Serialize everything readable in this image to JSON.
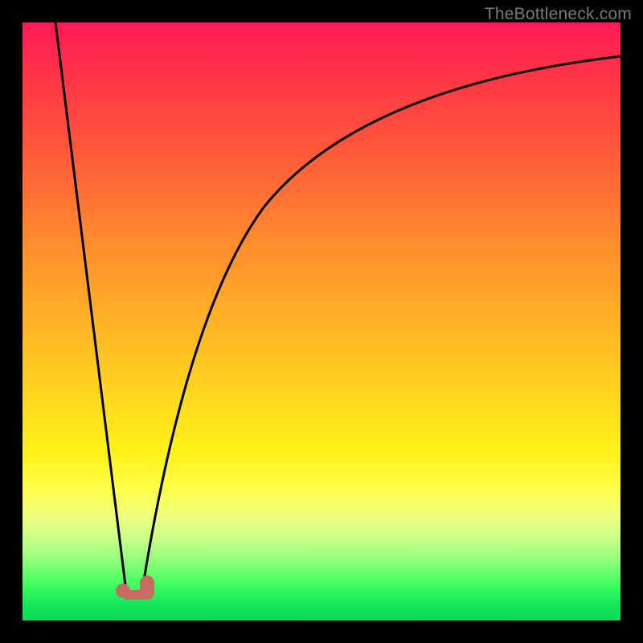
{
  "watermark": "TheBottleneck.com",
  "chart_data": {
    "type": "line",
    "title": "",
    "xlabel": "",
    "ylabel": "",
    "xlim": [
      0,
      1
    ],
    "ylim": [
      0,
      1
    ],
    "series": [
      {
        "name": "curve",
        "x": [
          0.0,
          0.05,
          0.1,
          0.15,
          0.165,
          0.18,
          0.2,
          0.23,
          0.27,
          0.32,
          0.38,
          0.45,
          0.55,
          0.65,
          0.78,
          0.9,
          1.0
        ],
        "y": [
          1.0,
          0.7,
          0.4,
          0.1,
          0.015,
          0.015,
          0.05,
          0.14,
          0.28,
          0.42,
          0.55,
          0.66,
          0.76,
          0.82,
          0.87,
          0.9,
          0.92
        ]
      }
    ],
    "marker": {
      "x_start": 0.145,
      "x_end": 0.205,
      "y": 0.015
    },
    "colors": {
      "curve": "#000000",
      "marker": "#c86b62",
      "gradient_top": "#ff1a58",
      "gradient_bottom": "#0fd858"
    }
  }
}
